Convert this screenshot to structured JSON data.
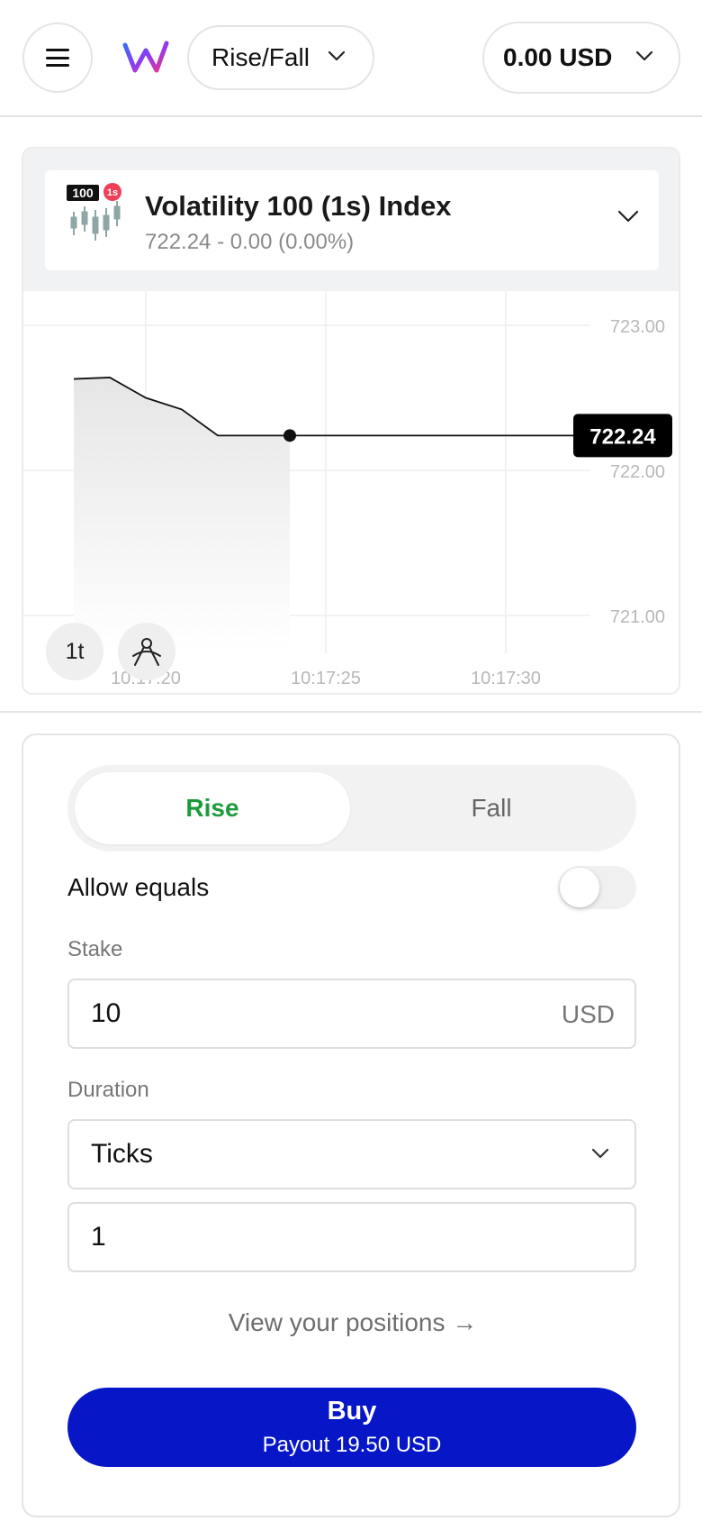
{
  "header": {
    "menu_icon": "hamburger-icon",
    "logo_icon": "brand-w-logo",
    "trade_type_label": "Rise/Fall",
    "balance_label": "0.00 USD"
  },
  "symbol": {
    "badge_value": "100",
    "badge_tick": "1s",
    "name": "Volatility 100 (1s) Index",
    "price_change": "722.24 - 0.00 (0.00%)"
  },
  "chart_data": {
    "type": "area",
    "x": [
      "10:17:18",
      "10:17:19",
      "10:17:20",
      "10:17:21",
      "10:17:22",
      "10:17:23",
      "10:17:24"
    ],
    "values": [
      722.63,
      722.64,
      722.5,
      722.42,
      722.24,
      722.24,
      722.24
    ],
    "current_price": "722.24",
    "y_ticks": [
      "723.00",
      "722.00",
      "721.00"
    ],
    "x_ticks": [
      "10:17:20",
      "10:17:25",
      "10:17:30"
    ],
    "ylim": [
      720.7,
      723.3
    ],
    "grid": true
  },
  "chart_controls": {
    "interval_label": "1t",
    "draw_icon": "drawing-tools-icon"
  },
  "trade": {
    "rise_label": "Rise",
    "fall_label": "Fall",
    "allow_equals_label": "Allow equals",
    "allow_equals_on": false,
    "stake_label": "Stake",
    "stake_value": "10",
    "stake_currency": "USD",
    "duration_label": "Duration",
    "duration_unit": "Ticks",
    "duration_value": "1",
    "positions_link": "View your positions →",
    "buy_label": "Buy",
    "payout_label": "Payout 19.50 USD"
  },
  "colors": {
    "buy": "#0717c8",
    "rise": "#1d9b3b",
    "price_tag": "#000000"
  }
}
